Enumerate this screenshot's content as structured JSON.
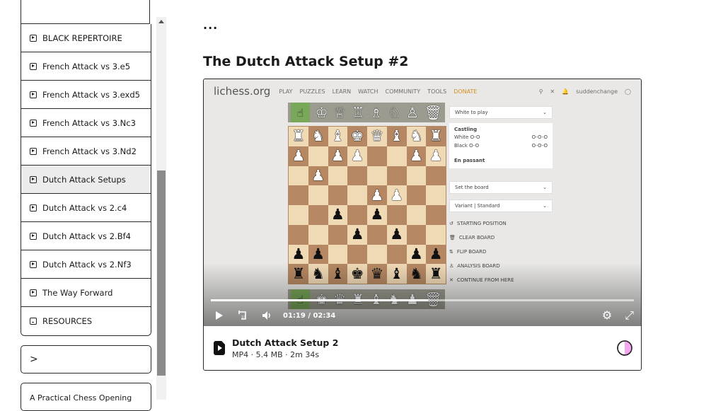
{
  "sidebar": {
    "lessons": [
      {
        "label": "BLACK REPERTOIRE",
        "icon": "play-file-icon",
        "active": false
      },
      {
        "label": "French Attack vs 3.e5",
        "icon": "play-file-icon",
        "active": false
      },
      {
        "label": "French Attack vs 3.exd5",
        "icon": "play-file-icon",
        "active": false
      },
      {
        "label": "French Attack vs 3.Nc3",
        "icon": "play-file-icon",
        "active": false
      },
      {
        "label": "French Attack vs 3.Nd2",
        "icon": "play-file-icon",
        "active": false
      },
      {
        "label": "Dutch Attack Setups",
        "icon": "play-file-icon",
        "active": true
      },
      {
        "label": "Dutch Attack vs 2.c4",
        "icon": "play-file-icon",
        "active": false
      },
      {
        "label": "Dutch Attack vs 2.Bf4",
        "icon": "play-file-icon",
        "active": false
      },
      {
        "label": "Dutch Attack vs 2.Nf3",
        "icon": "play-file-icon",
        "active": false
      },
      {
        "label": "The Way Forward",
        "icon": "play-file-icon",
        "active": false
      },
      {
        "label": "RESOURCES",
        "icon": "download-file-icon",
        "active": false
      }
    ],
    "expand_label": ">",
    "course_card_label": "A Practical Chess Opening"
  },
  "main": {
    "ellipsis": "...",
    "title": "The Dutch Attack Setup #2"
  },
  "video": {
    "current_time": "01:19",
    "separator": "/",
    "duration": "02:34",
    "progress": 0.513,
    "frame": {
      "logo": "lichess.org",
      "nav": [
        "PLAY",
        "PUZZLES",
        "LEARN",
        "WATCH",
        "COMMUNITY",
        "TOOLS",
        "DONATE"
      ],
      "username": "suddenchange",
      "turn_select": "White to play",
      "castling_label": "Castling",
      "white_castling": "White O-O",
      "black_castling": "Black O-O",
      "ooo": "O-O-O",
      "en_passant": "En passant",
      "set_board": "Set the board",
      "variant": "Variant | Standard",
      "commands": [
        "STARTING POSITION",
        "CLEAR BOARD",
        "FLIP BOARD",
        "ANALYSIS BOARD",
        "CONTINUE FROM HERE"
      ],
      "board": [
        [
          "wr",
          "wn",
          "wb",
          "wk",
          "wq",
          "wb",
          "wn",
          "wr"
        ],
        [
          "wp",
          "",
          "wp",
          "wp",
          "",
          "",
          "wp",
          "wp"
        ],
        [
          "",
          "wp",
          "",
          "",
          "",
          "",
          "",
          ""
        ],
        [
          "",
          "",
          "",
          "",
          "wp",
          "wp",
          "",
          ""
        ],
        [
          "",
          "",
          "bp",
          "",
          "bp",
          "",
          "",
          ""
        ],
        [
          "",
          "",
          "",
          "bp",
          "",
          "bp",
          "",
          ""
        ],
        [
          "bp",
          "bp",
          "",
          "",
          "",
          "",
          "bp",
          "bp"
        ],
        [
          "br",
          "bn",
          "bb",
          "bk",
          "bq",
          "bb",
          "bn",
          "br"
        ]
      ]
    }
  },
  "file": {
    "name": "Dutch Attack Setup 2",
    "meta": "MP4 · 5.4 MB · 2m 34s"
  },
  "colors": {
    "accent_circle": "#f4a6f0",
    "board_light": "#f0d9b5",
    "board_dark": "#b58863"
  }
}
